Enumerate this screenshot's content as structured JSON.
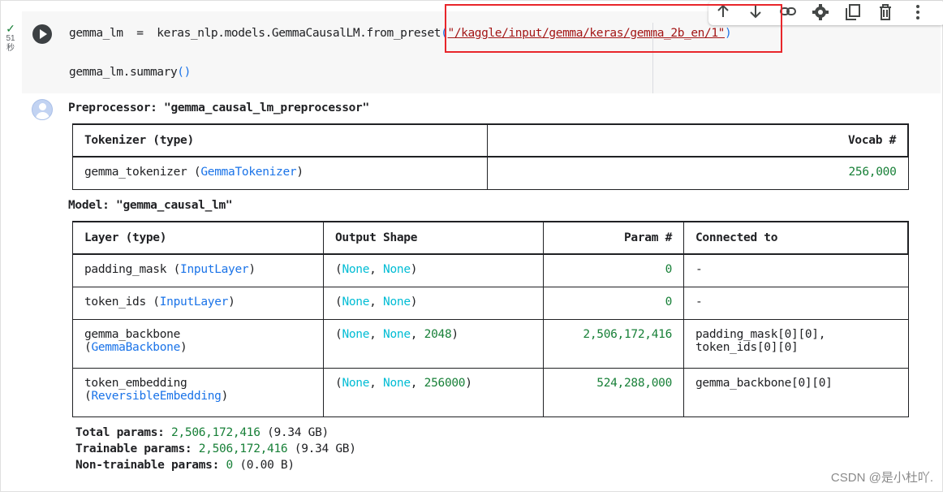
{
  "gutter": {
    "check": "✓",
    "time_value": "51",
    "time_unit": "秒"
  },
  "code": {
    "line1_prefix": "gemma_lm  =  keras_nlp.models.GemmaCausalLM.from_preset",
    "line1_open": "(",
    "line1_string": "\"/kaggle/input/gemma/keras/gemma_2b_en/1\"",
    "line1_close": ")",
    "line2_prefix": "gemma_lm.summary",
    "line2_parens": "()"
  },
  "toolbar": {
    "icons": [
      "arrow-up-icon",
      "arrow-down-icon",
      "link-icon",
      "gear-icon",
      "copy-icon",
      "trash-icon",
      "more-vert-icon"
    ]
  },
  "output": {
    "preprocessor_heading": "Preprocessor: \"gemma_causal_lm_preprocessor\"",
    "tokenizer_table": {
      "headers": [
        "Tokenizer (type)",
        "Vocab #"
      ],
      "row": {
        "name": "gemma_tokenizer",
        "open": " (",
        "type": "GemmaTokenizer",
        "close": ")",
        "vocab": "256,000"
      }
    },
    "model_heading": "Model: \"gemma_causal_lm\"",
    "layer_table": {
      "headers": [
        "Layer (type)",
        "Output Shape",
        "Param #",
        "Connected to"
      ],
      "rows": [
        {
          "name": "padding_mask",
          "open": " (",
          "type": "InputLayer",
          "close": ")",
          "shape": [
            "(",
            "None",
            ", ",
            "None",
            ")"
          ],
          "params": "0",
          "connected": "-"
        },
        {
          "name": "token_ids",
          "open": " (",
          "type": "InputLayer",
          "close": ")",
          "shape": [
            "(",
            "None",
            ", ",
            "None",
            ")"
          ],
          "params": "0",
          "connected": "-"
        },
        {
          "name": "gemma_backbone",
          "open": "(",
          "type": "GemmaBackbone",
          "close": ")",
          "shape": [
            "(",
            "None",
            ", ",
            "None",
            ", ",
            "2048",
            ")"
          ],
          "params": "2,506,172,416",
          "connected": "padding_mask[0][0],",
          "connected2": "token_ids[0][0]"
        },
        {
          "name": "token_embedding",
          "open": "(",
          "type": "ReversibleEmbedding",
          "close": ")",
          "shape": [
            "(",
            "None",
            ", ",
            "None",
            ", ",
            "256000",
            ")"
          ],
          "params": "524,288,000",
          "connected": "gemma_backbone[0][0]"
        }
      ]
    },
    "totals": {
      "total_label": "Total params:",
      "total_value": "2,506,172,416",
      "total_size": "(9.34 GB)",
      "trainable_label": "Trainable params:",
      "trainable_value": "2,506,172,416",
      "trainable_size": "(9.34 GB)",
      "nontrainable_label": "Non-trainable params:",
      "nontrainable_value": "0",
      "nontrainable_size": "(0.00 B)"
    }
  },
  "watermark": "CSDN @是小杜吖.",
  "colors": {
    "highlight": "#e8262b",
    "class_name": "#1a73e8",
    "none_value": "#00bcd4",
    "number": "#188038"
  }
}
